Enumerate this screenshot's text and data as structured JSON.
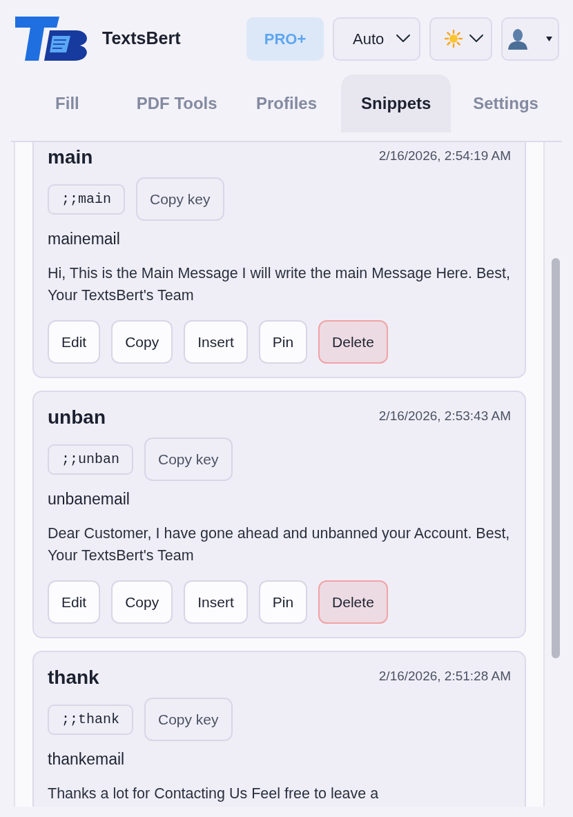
{
  "app": {
    "name": "TextsBert"
  },
  "toolbar": {
    "plan_badge": "PRO+",
    "mode_select": {
      "value": "Auto"
    }
  },
  "tabs": [
    {
      "label": "Fill",
      "selected": false
    },
    {
      "label": "PDF Tools",
      "selected": false
    },
    {
      "label": "Profiles",
      "selected": false
    },
    {
      "label": "Snippets",
      "selected": true
    },
    {
      "label": "Settings",
      "selected": false
    }
  ],
  "snippets": [
    {
      "title": "main",
      "date": "2/16/2026, 2:54:19 AM",
      "key": ";;main",
      "copy_key": "Copy key",
      "subtitle": "mainemail",
      "body": "Hi, This is the Main Message I will write the main Message Here. Best, Your TextsBert's Team",
      "actions": [
        {
          "label": "Edit",
          "kind": "normal"
        },
        {
          "label": "Copy",
          "kind": "normal"
        },
        {
          "label": "Insert",
          "kind": "normal"
        },
        {
          "label": "Pin",
          "kind": "normal"
        },
        {
          "label": "Delete",
          "kind": "danger"
        }
      ]
    },
    {
      "title": "unban",
      "date": "2/16/2026, 2:53:43 AM",
      "key": ";;unban",
      "copy_key": "Copy key",
      "subtitle": "unbanemail",
      "body": "Dear Customer, I have gone ahead and unbanned your Account. Best, Your TextsBert's Team",
      "actions": [
        {
          "label": "Edit",
          "kind": "normal"
        },
        {
          "label": "Copy",
          "kind": "normal"
        },
        {
          "label": "Insert",
          "kind": "normal"
        },
        {
          "label": "Pin",
          "kind": "normal"
        },
        {
          "label": "Delete",
          "kind": "danger"
        }
      ]
    },
    {
      "title": "thank",
      "date": "2/16/2026, 2:51:28 AM",
      "key": ";;thank",
      "copy_key": "Copy key",
      "subtitle": "thankemail",
      "body": "Thanks a lot for Contacting Us Feel free to leave a"
    }
  ]
}
